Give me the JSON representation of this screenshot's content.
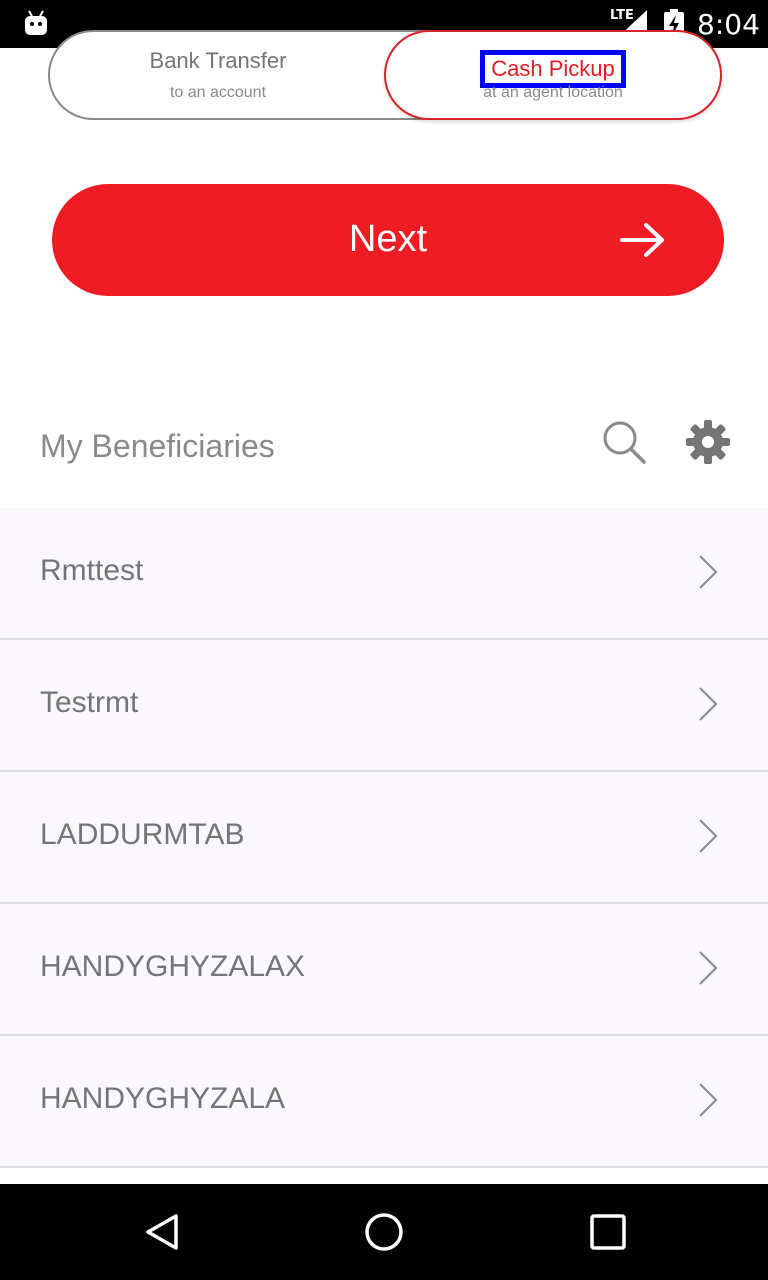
{
  "status_bar": {
    "network": "LTE",
    "time": "8:04",
    "icons": [
      "android-debug-icon",
      "lte-signal-icon",
      "battery-charging-icon"
    ]
  },
  "transfer_toggle": {
    "options": [
      {
        "title": "Bank Transfer",
        "subtitle": "to an account",
        "selected": false
      },
      {
        "title": "Cash Pickup",
        "subtitle": "at an agent location",
        "selected": true
      }
    ]
  },
  "next_button": {
    "label": "Next",
    "icon": "arrow-right-icon"
  },
  "beneficiaries": {
    "title": "My Beneficiaries",
    "actions": [
      "search-icon",
      "gear-icon"
    ],
    "items": [
      {
        "name": "Rmttest"
      },
      {
        "name": "Testrmt"
      },
      {
        "name": "LADDURMTAB"
      },
      {
        "name": "HANDYGHYZALAX"
      },
      {
        "name": "HANDYGHYZALA"
      }
    ]
  },
  "nav_bar": {
    "buttons": [
      "back-icon",
      "home-icon",
      "recents-icon"
    ]
  },
  "colors": {
    "accent": "#f01c24",
    "selected_text": "#e31b23",
    "highlight_box": "#0000ff",
    "list_bg": "#fbf8fd"
  }
}
